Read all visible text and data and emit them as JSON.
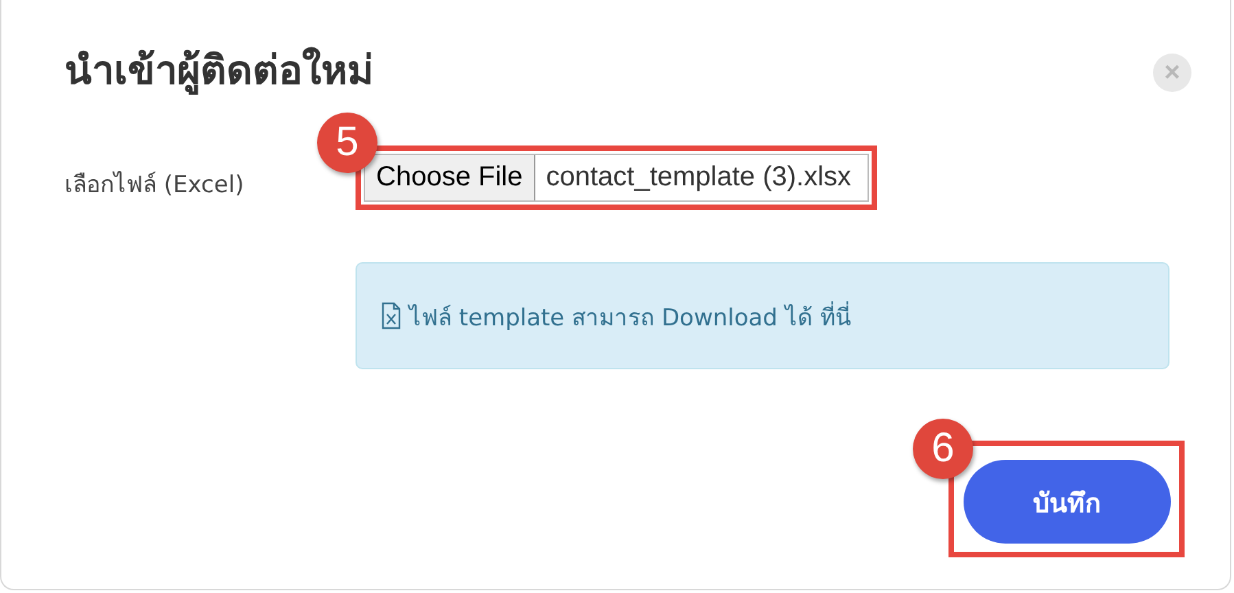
{
  "dialog": {
    "title": "นำเข้าผู้ติดต่อใหม่",
    "close_label": "×"
  },
  "file_field": {
    "label": "เลือกไฟล์ (Excel)",
    "button": "Choose File",
    "value": "contact_template (3).xlsx",
    "marker": "5"
  },
  "notice": {
    "text": "ไฟล์ template สามารถ Download ได้ ที่นี่"
  },
  "save_button": {
    "label": "บันทึก",
    "marker": "6"
  }
}
